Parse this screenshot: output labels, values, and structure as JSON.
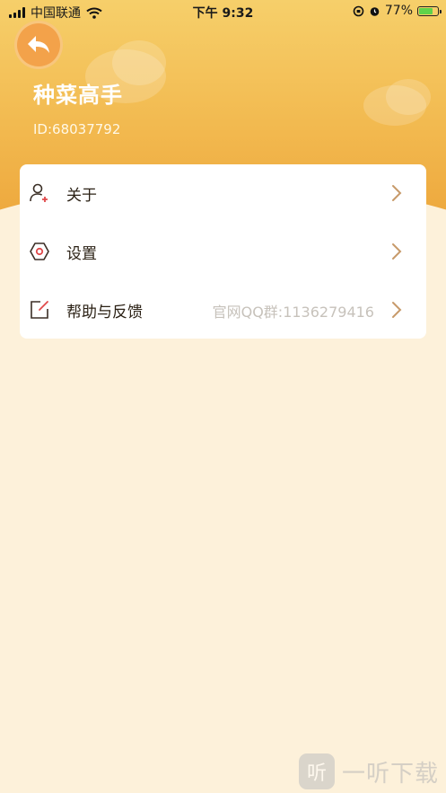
{
  "status_bar": {
    "carrier": "中国联通",
    "time": "下午 9:32",
    "battery_percent": "77%",
    "battery_level": 0.77,
    "icons": [
      "signal-icon",
      "wifi-icon",
      "screen-lock-icon",
      "alarm-icon",
      "battery-icon"
    ]
  },
  "header": {
    "back_icon": "back-arrow-icon",
    "title": "种菜高手",
    "user_id": "ID:68037792"
  },
  "menu": {
    "items": [
      {
        "icon": "user-add-icon",
        "label": "关于",
        "extra": ""
      },
      {
        "icon": "settings-icon",
        "label": "设置",
        "extra": ""
      },
      {
        "icon": "edit-feedback-icon",
        "label": "帮助与反馈",
        "extra": "官网QQ群:1136279416"
      }
    ]
  },
  "watermark": {
    "text": "一听下载",
    "logo_char": "听"
  },
  "colors": {
    "header_top": "#f6cf6a",
    "header_bottom": "#eda53a",
    "page_bg": "#fdf1da",
    "chevron": "#c79a6a",
    "accent_red": "#e0494a"
  }
}
